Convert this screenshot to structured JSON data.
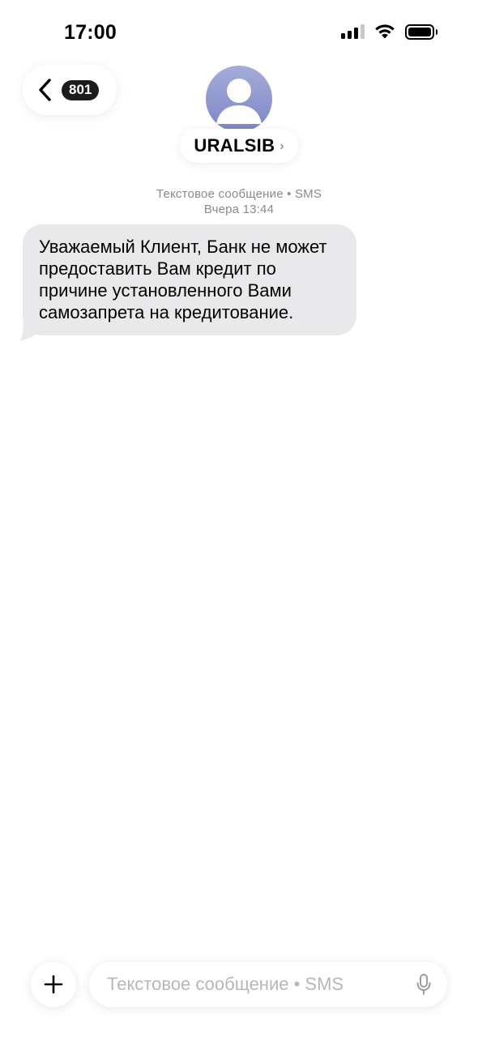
{
  "status_bar": {
    "time": "17:00",
    "signal_icon": "cellular-signal-icon",
    "wifi_icon": "wifi-icon",
    "battery_icon": "battery-icon"
  },
  "nav": {
    "back_icon": "chevron-left-icon",
    "unread_count": "801",
    "contact_name": "URALSIB",
    "contact_chevron": "›",
    "avatar_icon": "person-icon"
  },
  "conversation": {
    "message_type": "Текстовое сообщение • SMS",
    "timestamp": "Вчера 13:44",
    "messages": [
      {
        "direction": "incoming",
        "text": "Уважаемый Клиент, Банк не может предоставить Вам кредит по причине установленного Вами самозапрета на кредитование."
      }
    ]
  },
  "composer": {
    "plus_icon": "plus-icon",
    "placeholder": "Текстовое сообщение • SMS",
    "value": "",
    "mic_icon": "microphone-icon"
  },
  "colors": {
    "incoming_bubble": "#e9e9eb",
    "badge": "#1c1c1e",
    "meta_text": "#8a8a8e",
    "avatar_gradient_top": "#a5acda",
    "avatar_gradient_bottom": "#7c86c6"
  }
}
